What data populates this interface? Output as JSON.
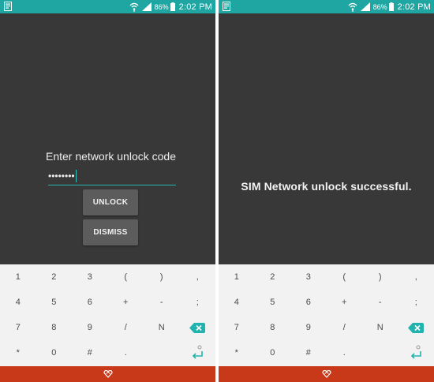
{
  "status_bar": {
    "battery_percent": "86%",
    "time": "2:02 PM"
  },
  "unlock_screen": {
    "prompt": "Enter network unlock code",
    "pin_value": "••••••••",
    "unlock_label": "UNLOCK",
    "dismiss_label": "DISMISS"
  },
  "success_screen": {
    "message": "SIM Network unlock successful."
  },
  "keyboard": {
    "row1": [
      "1",
      "2",
      "3",
      "(",
      ")",
      ","
    ],
    "row2": [
      "4",
      "5",
      "6",
      "+",
      "-",
      ";"
    ],
    "row3": [
      "7",
      "8",
      "9",
      "/",
      "N"
    ],
    "row4": [
      "*",
      "0",
      "#",
      "."
    ],
    "icons": {
      "backspace": "backspace-icon",
      "enter": "enter-icon",
      "logo": "swiftkey-logo-icon"
    }
  },
  "colors": {
    "status_bar": "#1fa6a2",
    "screen_bg": "#383838",
    "input_underline": "#25b5b0",
    "button_bg": "#5c5c5c",
    "keyboard_bg": "#f2f2f2",
    "accent_key": "#21b3ae",
    "bottom_bar": "#c8391a"
  }
}
